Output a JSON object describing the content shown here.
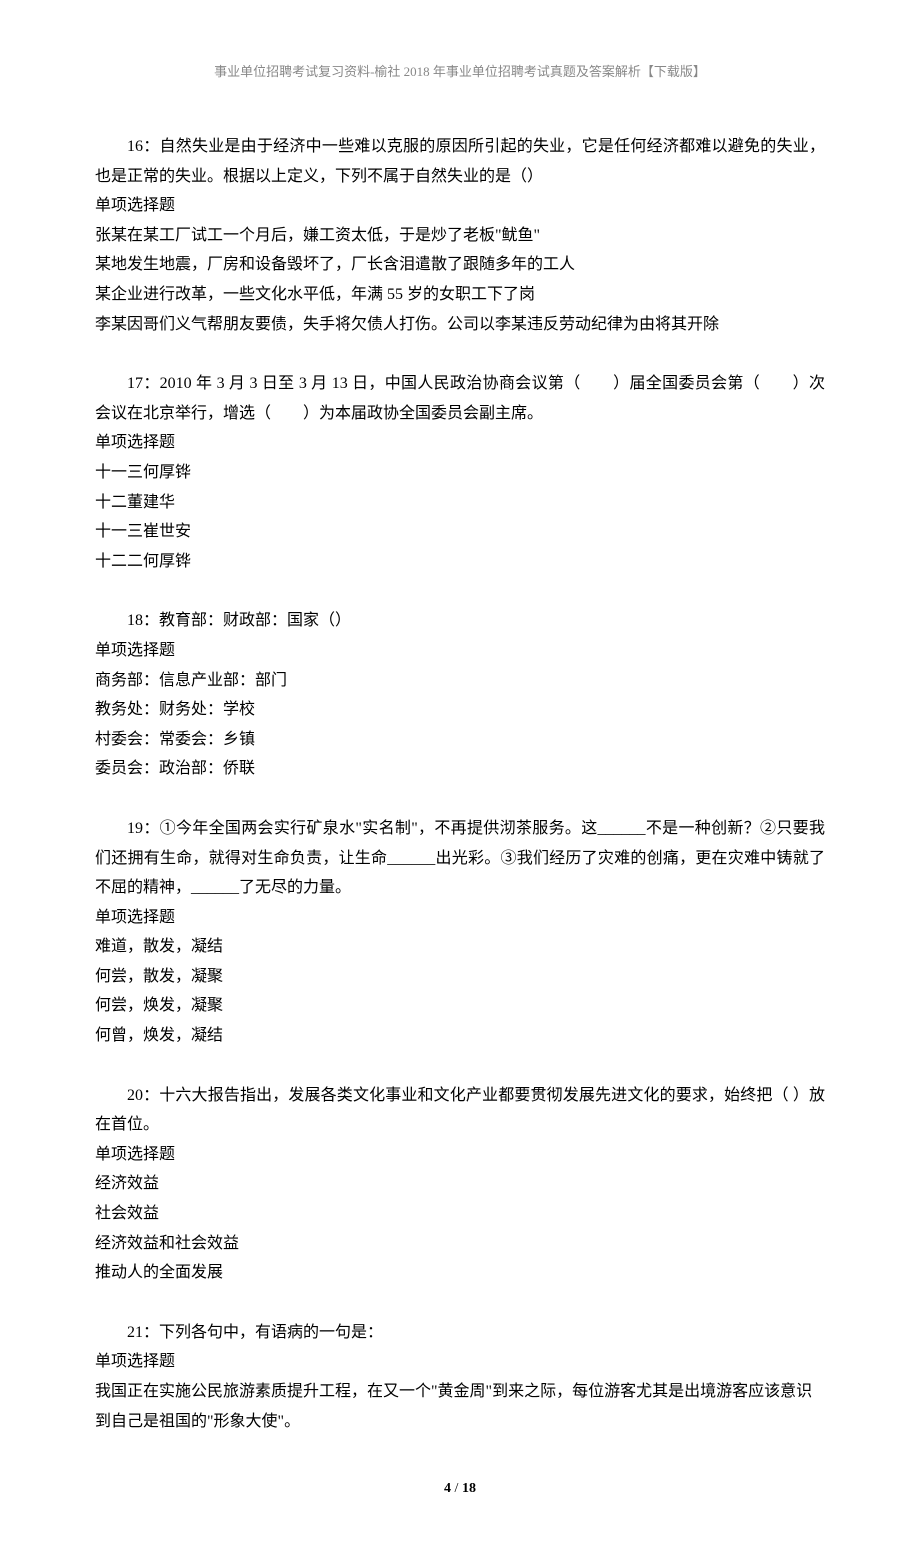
{
  "header": "事业单位招聘考试复习资料-榆社 2018 年事业单位招聘考试真题及答案解析【下载版】",
  "questions": {
    "q16": {
      "text": "16：自然失业是由于经济中一些难以克服的原因所引起的失业，它是任何经济都难以避免的失业，也是正常的失业。根据以上定义，下列不属于自然失业的是（）",
      "type": "单项选择题",
      "options": [
        "张某在某工厂试工一个月后，嫌工资太低，于是炒了老板\"鱿鱼\"",
        "某地发生地震，厂房和设备毁坏了，厂长含泪遣散了跟随多年的工人",
        "某企业进行改革，一些文化水平低，年满 55 岁的女职工下了岗",
        "李某因哥们义气帮朋友要债，失手将欠债人打伤。公司以李某违反劳动纪律为由将其开除"
      ]
    },
    "q17": {
      "text": "17：2010 年 3 月 3 日至 3 月 13 日，中国人民政治协商会议第（　　）届全国委员会第（　　）次会议在北京举行，增选（　　）为本届政协全国委员会副主席。",
      "type": "单项选择题",
      "options": [
        "十一三何厚铧",
        "十二董建华",
        "十一三崔世安",
        "十二二何厚铧"
      ]
    },
    "q18": {
      "text": "18：教育部：财政部：国家（）",
      "type": "单项选择题",
      "options": [
        "商务部：信息产业部：部门",
        "教务处：财务处：学校",
        "村委会：常委会：乡镇",
        "委员会：政治部：侨联"
      ]
    },
    "q19": {
      "text": "19：①今年全国两会实行矿泉水\"实名制\"，不再提供沏茶服务。这______不是一种创新？②只要我们还拥有生命，就得对生命负责，让生命______出光彩。③我们经历了灾难的创痛，更在灾难中铸就了不屈的精神，______了无尽的力量。",
      "type": "单项选择题",
      "options": [
        "难道，散发，凝结",
        "何尝，散发，凝聚",
        "何尝，焕发，凝聚",
        "何曾，焕发，凝结"
      ]
    },
    "q20": {
      "text": "20：十六大报告指出，发展各类文化事业和文化产业都要贯彻发展先进文化的要求，始终把（  ）放在首位。",
      "type": "单项选择题",
      "options": [
        "经济效益",
        "社会效益",
        "经济效益和社会效益",
        "推动人的全面发展"
      ]
    },
    "q21": {
      "text": "21：下列各句中，有语病的一句是：",
      "type": "单项选择题",
      "options": [
        "我国正在实施公民旅游素质提升工程，在又一个\"黄金周\"到来之际，每位游客尤其是出境游客应该意识到自己是祖国的\"形象大使\"。"
      ]
    }
  },
  "footer": {
    "current": "4",
    "sep": " / ",
    "total": "18"
  }
}
